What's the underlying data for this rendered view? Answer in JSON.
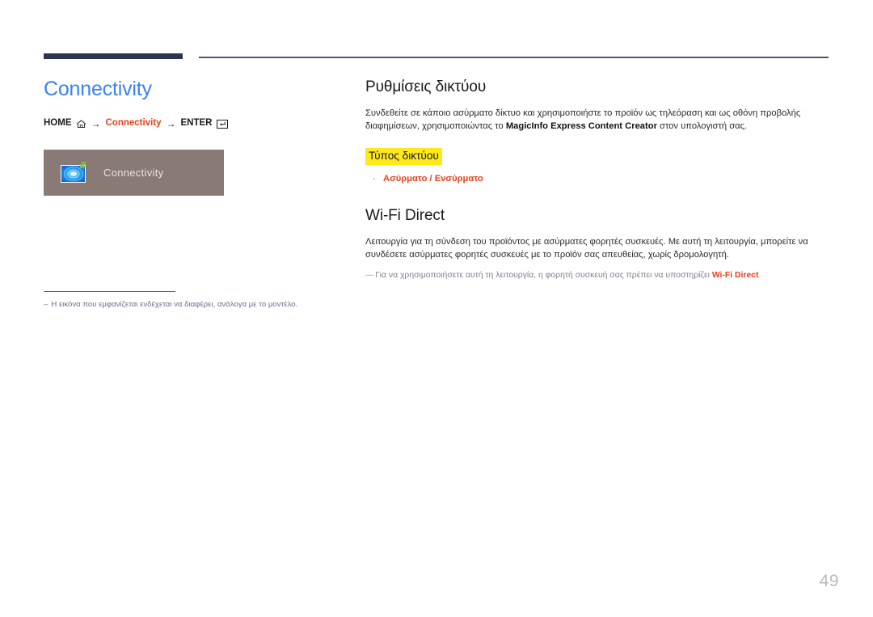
{
  "document": {
    "page_number": "49"
  },
  "header": {
    "accent_color": "#2e3455",
    "rule_color": "#4f5476"
  },
  "left": {
    "title": "Connectivity",
    "title_color": "#3a81f2",
    "breadcrumb": {
      "home_label": "HOME",
      "home_icon": "home-icon",
      "arrow_1": "→",
      "link_label": "Connectivity",
      "link_color": "#e8401c",
      "arrow_2": "→",
      "enter_label": "ENTER",
      "enter_icon": "enter-key-icon"
    },
    "thumbnail": {
      "background_color": "#8a7a76",
      "label": "Connectivity",
      "icon_name": "connectivity-screen-icon",
      "wifi_icon_color": "#8cc63e"
    },
    "note": "Η εικόνα που εμφανίζεται ενδέχεται να διαφέρει, ανάλογα με το μοντέλο.",
    "note_dash": "–"
  },
  "right": {
    "section1": {
      "heading": "Ρυθμίσεις δικτύου",
      "paragraph_part1": "Συνδεθείτε σε κάποιο ασύρματο δίκτυο και χρησιμοποιήστε το προϊόν ως τηλεόραση και ως οθόνη προβολής διαφημίσεων, χρησιμοποιώντας το ",
      "paragraph_bold": "MagicInfo Express Content Creator",
      "paragraph_part2": " στον υπολογιστή σας.",
      "highlight_heading": "Τύπος δικτύου",
      "highlight_color": "#ffe81c",
      "bullet_dot": "·",
      "bullet_option_1": "Ασύρματο",
      "bullet_separator": " / ",
      "bullet_option_2": "Ενσύρματο"
    },
    "section2": {
      "heading": "Wi-Fi Direct",
      "paragraph": "Λειτουργία για τη σύνδεση του προϊόντος με ασύρματες φορητές συσκευές. Με αυτή τη λειτουργία, μπορείτε να συνδέσετε ασύρματες φορητές συσκευές με το προϊόν σας απευθείας, χωρίς δρομολογητή.",
      "note_dash": "—",
      "note_part1": "Για να χρησιμοποιήσετε αυτή τη λειτουργία, η φορητή συσκευή σας πρέπει να υποστηρίζει ",
      "note_term": "Wi-Fi Direct",
      "note_part2": "."
    }
  }
}
